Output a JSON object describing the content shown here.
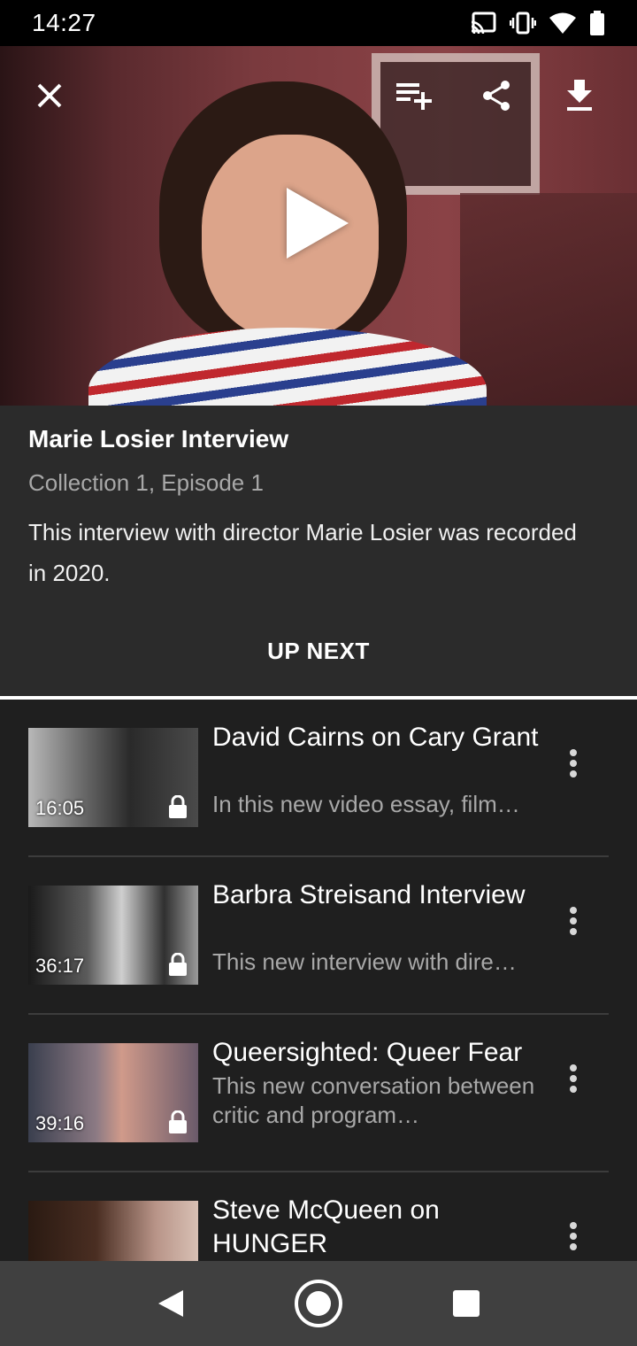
{
  "status_bar": {
    "time": "14:27",
    "icons": [
      "cast-icon",
      "vibrate-icon",
      "wifi-icon",
      "battery-icon"
    ]
  },
  "hero": {
    "icons": [
      "close-icon",
      "add-to-queue-icon",
      "share-icon",
      "download-icon",
      "play-icon"
    ]
  },
  "video": {
    "title": "Marie Losier Interview",
    "subtitle": "Collection 1, Episode 1",
    "description": "This interview with director Marie Losier was recorded in 2020."
  },
  "up_next": {
    "label": "UP NEXT",
    "items": [
      {
        "title": "David Cairns on Cary Grant",
        "description": "In this new video essay, film…",
        "duration": "16:05",
        "locked": true
      },
      {
        "title": "Barbra Streisand Interview",
        "description": "This new interview with dire…",
        "duration": "36:17",
        "locked": true
      },
      {
        "title": "Queersighted: Queer Fear",
        "description": "This new conversation between critic and program…",
        "duration": "39:16",
        "locked": true
      },
      {
        "title": "Steve McQueen on HUNGER",
        "description": "",
        "duration": "",
        "locked": false
      }
    ]
  },
  "nav_bar": {
    "icons": [
      "back-icon",
      "home-icon",
      "recents-icon"
    ]
  }
}
